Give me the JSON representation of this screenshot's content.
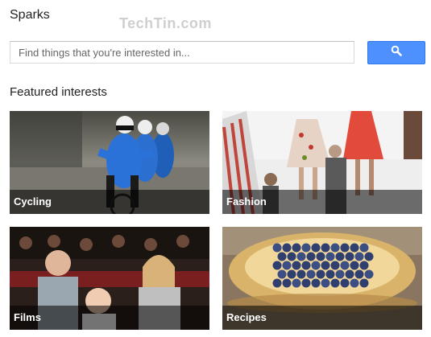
{
  "app": {
    "title": "Sparks",
    "watermark": "TechTin.com"
  },
  "search": {
    "placeholder": "Find things that you're interested in...",
    "button_icon": "search-icon"
  },
  "featured": {
    "heading": "Featured interests",
    "items": [
      {
        "label": "Cycling"
      },
      {
        "label": "Fashion"
      },
      {
        "label": "Films"
      },
      {
        "label": "Recipes"
      }
    ]
  },
  "colors": {
    "accent": "#4d90fe",
    "caption_bg": "#000000"
  }
}
